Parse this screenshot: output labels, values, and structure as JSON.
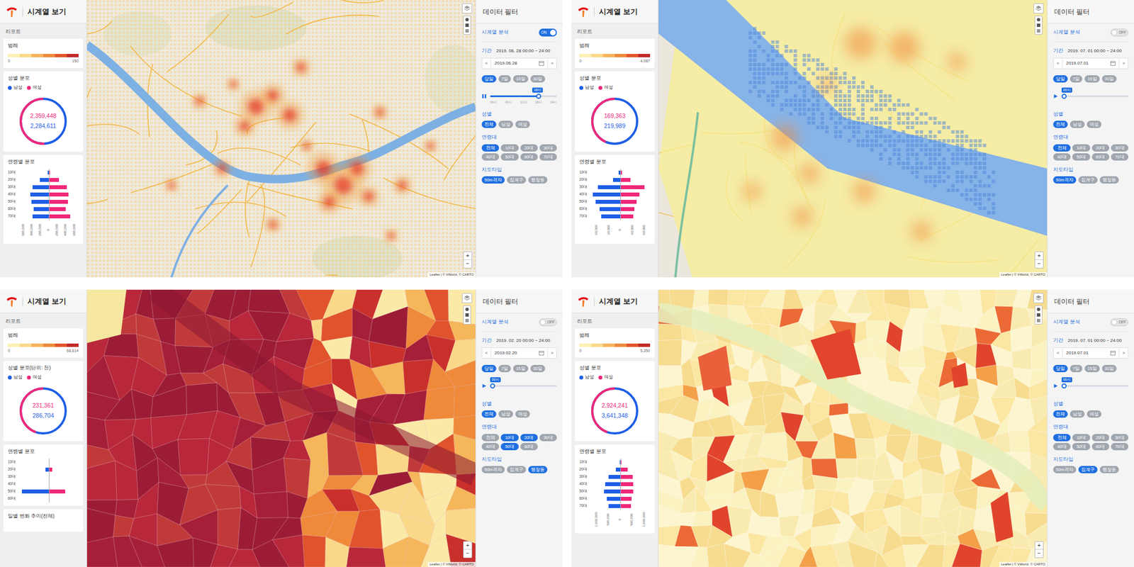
{
  "panels": [
    {
      "header": {
        "title": "시계열 보기"
      },
      "report_label": "리포트",
      "legend": {
        "title": "범례",
        "min": "0",
        "max": "150"
      },
      "gender": {
        "title": "성별 분포",
        "legend": [
          {
            "label": "남성",
            "color": "#1e5ee6"
          },
          {
            "label": "여성",
            "color": "#f0287a"
          }
        ],
        "female": "2,359,448",
        "male": "2,284,611"
      },
      "age": {
        "title": "연령별 분포",
        "labels": [
          "10대",
          "20대",
          "30대",
          "40대",
          "50대",
          "60대",
          "70대"
        ],
        "male": [
          15000,
          180000,
          330000,
          370000,
          350000,
          300000,
          330000
        ],
        "female": [
          20000,
          200000,
          360000,
          390000,
          380000,
          340000,
          430000
        ],
        "max": 600000,
        "ticks": [
          "600,000",
          "400,000",
          "200,000",
          "0",
          "200,000",
          "400,000",
          "600,000"
        ]
      },
      "map": {
        "kind": "heatmap-grid",
        "zoom_in": "+",
        "zoom_out": "−",
        "attribution": "Leaflet | © VWorld, © CARTO"
      },
      "filter": {
        "title": "데이터 필터",
        "timeseries": {
          "label": "시계열 분석",
          "on": true,
          "text": "ON"
        },
        "period": {
          "label": "기간",
          "value": "2019. 06. 28 00:00 ~ 24:00"
        },
        "date": {
          "prev": "<",
          "value": "2019.06.28",
          "next": ">"
        },
        "ranges": [
          {
            "label": "당일",
            "selected": true
          },
          {
            "label": "7일",
            "selected": false
          },
          {
            "label": "15일",
            "selected": false
          },
          {
            "label": "30일",
            "selected": false
          }
        ],
        "slider": {
          "playing": true,
          "level": 0.75,
          "bubble": "18시",
          "ticks": [
            "00시",
            "06시",
            "12시",
            "18시",
            "24시"
          ]
        },
        "gender": {
          "label": "성별",
          "options": [
            {
              "label": "전체",
              "selected": true
            },
            {
              "label": "남성",
              "selected": false
            },
            {
              "label": "여성",
              "selected": false
            }
          ]
        },
        "ages": {
          "label": "연령대",
          "options": [
            {
              "label": "전체",
              "selected": true
            },
            {
              "label": "10대",
              "selected": false
            },
            {
              "label": "20대",
              "selected": false
            },
            {
              "label": "30대",
              "selected": false
            },
            {
              "label": "40대",
              "selected": false
            },
            {
              "label": "50대",
              "selected": false
            },
            {
              "label": "60대",
              "selected": false
            },
            {
              "label": "70대",
              "selected": false
            }
          ]
        },
        "maptype": {
          "label": "지도타입",
          "options": [
            {
              "label": "50m격자",
              "selected": true
            },
            {
              "label": "집계구",
              "selected": false
            },
            {
              "label": "행정동",
              "selected": false
            }
          ]
        }
      }
    },
    {
      "header": {
        "title": "시계열 보기"
      },
      "report_label": "리포트",
      "legend": {
        "title": "범례",
        "min": "0",
        "max": "4,087"
      },
      "gender": {
        "title": "성별 분포",
        "legend": [
          {
            "label": "남성",
            "color": "#1e5ee6"
          },
          {
            "label": "여성",
            "color": "#f0287a"
          }
        ],
        "female": "169,363",
        "male": "219,989"
      },
      "age": {
        "title": "연령별 분포",
        "labels": [
          "10대",
          "20대",
          "30대",
          "40대",
          "50대",
          "60대",
          "70대"
        ],
        "male": [
          3000,
          14000,
          45000,
          55000,
          50000,
          42000,
          38000
        ],
        "female": [
          3000,
          20000,
          48000,
          38000,
          33000,
          28000,
          26000
        ],
        "max": 60000,
        "ticks": [
          "60,000",
          "30,000",
          "0",
          "30,000",
          "60,000"
        ]
      },
      "map": {
        "kind": "heatmap-blur",
        "zoom_in": "+",
        "zoom_out": "−",
        "attribution": "Leaflet | © VWorld, © CARTO"
      },
      "filter": {
        "title": "데이터 필터",
        "timeseries": {
          "label": "시계열 분석",
          "on": false,
          "text": "OFF"
        },
        "period": {
          "label": "기간",
          "value": "2019. 07. 01 00:00 ~ 24:00"
        },
        "date": {
          "prev": "<",
          "value": "2019.07.01",
          "next": ">"
        },
        "ranges": [
          {
            "label": "당일",
            "selected": true
          },
          {
            "label": "7일",
            "selected": false
          },
          {
            "label": "15일",
            "selected": false
          },
          {
            "label": "30일",
            "selected": false
          }
        ],
        "slider": {
          "playing": false,
          "level": 0,
          "bubble": "00시",
          "ticks": []
        },
        "gender": {
          "label": "성별",
          "options": [
            {
              "label": "전체",
              "selected": true
            },
            {
              "label": "남성",
              "selected": false
            },
            {
              "label": "여성",
              "selected": false
            }
          ]
        },
        "ages": {
          "label": "연령대",
          "options": [
            {
              "label": "전체",
              "selected": true
            },
            {
              "label": "10대",
              "selected": false
            },
            {
              "label": "20대",
              "selected": false
            },
            {
              "label": "30대",
              "selected": false
            },
            {
              "label": "40대",
              "selected": false
            },
            {
              "label": "50대",
              "selected": false
            },
            {
              "label": "60대",
              "selected": false
            },
            {
              "label": "70대",
              "selected": false
            }
          ]
        },
        "maptype": {
          "label": "지도타입",
          "options": [
            {
              "label": "50m격자",
              "selected": true
            },
            {
              "label": "집계구",
              "selected": false
            },
            {
              "label": "행정동",
              "selected": false
            }
          ]
        }
      }
    },
    {
      "header": {
        "title": "시계열 보기"
      },
      "report_label": "리포트",
      "legend": {
        "title": "범례",
        "min": "0",
        "max": "68,614"
      },
      "gender": {
        "title": "성별 분포(단위: 천)",
        "legend": [
          {
            "label": "남성",
            "color": "#1e5ee6"
          },
          {
            "label": "여성",
            "color": "#f0287a"
          }
        ],
        "female": "231,361",
        "male": "286,704"
      },
      "age": {
        "title": "연령별 분포",
        "labels": [
          "10대",
          "20대",
          "30대",
          "40대",
          "50대",
          "60대"
        ],
        "male": [
          0,
          25000,
          0,
          0,
          200000,
          0
        ],
        "female": [
          0,
          25000,
          0,
          0,
          120000,
          0
        ],
        "max": 220000,
        "ticks": []
      },
      "daily": {
        "title": "일별 변화 추이(전체)"
      },
      "map": {
        "kind": "choropleth-dark",
        "zoom_in": "+",
        "zoom_out": "−",
        "attribution": "Leaflet | © VWorld, © CARTO"
      },
      "filter": {
        "title": "데이터 필터",
        "timeseries": {
          "label": "시계열 분석",
          "on": false,
          "text": "OFF"
        },
        "period": {
          "label": "기간",
          "value": "2019. 02. 20 00:00 ~ 24:00"
        },
        "date": {
          "prev": "<",
          "value": "2019.02.20",
          "next": ">"
        },
        "ranges": [
          {
            "label": "당일",
            "selected": true
          },
          {
            "label": "7일",
            "selected": false
          },
          {
            "label": "15일",
            "selected": false
          },
          {
            "label": "30일",
            "selected": false
          }
        ],
        "slider": {
          "playing": false,
          "level": 0,
          "bubble": "00시",
          "ticks": []
        },
        "gender": {
          "label": "성별",
          "options": [
            {
              "label": "전체",
              "selected": true
            },
            {
              "label": "남성",
              "selected": false
            },
            {
              "label": "여성",
              "selected": false
            }
          ]
        },
        "ages": {
          "label": "연령대",
          "options": [
            {
              "label": "전체",
              "selected": false
            },
            {
              "label": "10대",
              "selected": true
            },
            {
              "label": "20대",
              "selected": true
            },
            {
              "label": "30대",
              "selected": false
            },
            {
              "label": "40대",
              "selected": false
            },
            {
              "label": "50대",
              "selected": true
            },
            {
              "label": "60대",
              "selected": false
            }
          ]
        },
        "maptype": {
          "label": "지도타입",
          "options": [
            {
              "label": "50m격자",
              "selected": false
            },
            {
              "label": "집계구",
              "selected": false
            },
            {
              "label": "행정동",
              "selected": true
            }
          ]
        }
      }
    },
    {
      "header": {
        "title": "시계열 보기"
      },
      "report_label": "리포트",
      "legend": {
        "title": "범례",
        "min": "0",
        "max": "5,350"
      },
      "gender": {
        "title": "성별 분포",
        "legend": [
          {
            "label": "남성",
            "color": "#1e5ee6"
          },
          {
            "label": "여성",
            "color": "#f0287a"
          }
        ],
        "female": "2,924,241",
        "male": "3,641,348"
      },
      "age": {
        "title": "연령별 분포",
        "labels": [
          "10대",
          "20대",
          "30대",
          "40대",
          "50대",
          "60대",
          "70대"
        ],
        "male": [
          10000,
          150000,
          400000,
          500000,
          550000,
          450000,
          400000
        ],
        "female": [
          15000,
          230000,
          400000,
          430000,
          420000,
          380000,
          350000
        ],
        "max": 1000000,
        "ticks": [
          "1,000,000",
          "500,000",
          "0",
          "500,000",
          "1,000,000"
        ]
      },
      "map": {
        "kind": "choropleth-light",
        "zoom_in": "+",
        "zoom_out": "−",
        "attribution": "Leaflet | © VWorld, © CARTO"
      },
      "filter": {
        "title": "데이터 필터",
        "timeseries": {
          "label": "시계열 분석",
          "on": false,
          "text": "OFF"
        },
        "period": {
          "label": "기간",
          "value": "2019. 07. 01 00:00 ~ 24:00"
        },
        "date": {
          "prev": "<",
          "value": "2019.07.01",
          "next": ">"
        },
        "ranges": [
          {
            "label": "당일",
            "selected": true
          },
          {
            "label": "7일",
            "selected": false
          },
          {
            "label": "15일",
            "selected": false
          },
          {
            "label": "30일",
            "selected": false
          }
        ],
        "slider": {
          "playing": false,
          "level": 0,
          "bubble": "00시",
          "ticks": []
        },
        "gender": {
          "label": "성별",
          "options": [
            {
              "label": "전체",
              "selected": true
            },
            {
              "label": "남성",
              "selected": false
            },
            {
              "label": "여성",
              "selected": false
            }
          ]
        },
        "ages": {
          "label": "연령대",
          "options": [
            {
              "label": "전체",
              "selected": true
            },
            {
              "label": "10대",
              "selected": false
            },
            {
              "label": "20대",
              "selected": false
            },
            {
              "label": "30대",
              "selected": false
            },
            {
              "label": "40대",
              "selected": false
            },
            {
              "label": "50대",
              "selected": false
            },
            {
              "label": "60대",
              "selected": false
            },
            {
              "label": "70대",
              "selected": false
            }
          ]
        },
        "maptype": {
          "label": "지도타입",
          "options": [
            {
              "label": "50m격자",
              "selected": false
            },
            {
              "label": "집계구",
              "selected": true
            },
            {
              "label": "행정동",
              "selected": false
            }
          ]
        }
      }
    }
  ]
}
